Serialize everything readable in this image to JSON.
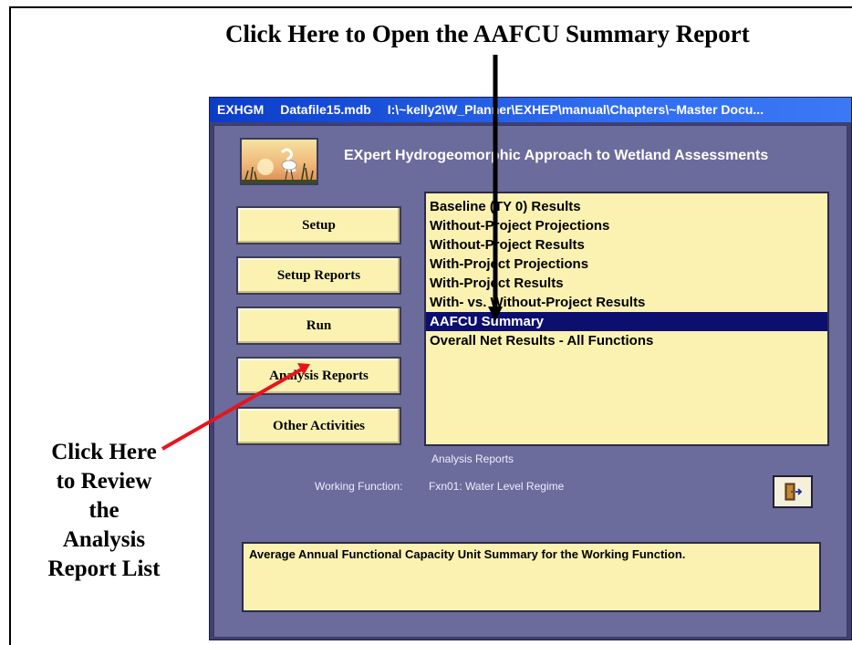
{
  "annotations": {
    "top_callout": "Click Here to Open the AAFCU Summary Report",
    "left_callout": [
      "Click Here",
      "to Review",
      "the",
      "Analysis",
      "Report List"
    ]
  },
  "window": {
    "title_parts": [
      "EXHGM",
      "Datafile15.mdb",
      "I:\\~kelly2\\W_Planner\\EXHEP\\manual\\Chapters\\~Master Docu..."
    ]
  },
  "app": {
    "title": "EXpert Hydrogeomorphic Approach to Wetland Assessments",
    "logo_icon": "heron-wetland-logo"
  },
  "nav": {
    "setup": "Setup",
    "setup_reports": "Setup Reports",
    "run": "Run",
    "analysis_reports": "Analysis Reports",
    "other_activities": "Other Activities"
  },
  "reports": {
    "items": [
      "Baseline (TY 0) Results",
      "Without-Project Projections",
      "Without-Project Results",
      "With-Project Projections",
      "With-Project Results",
      "With- vs. Without-Project Results",
      "AAFCU Summary",
      "Overall Net Results - All Functions"
    ],
    "selected": "AAFCU Summary",
    "caption": "Analysis Reports"
  },
  "working": {
    "label": "Working Function:",
    "value": "Fxn01: Water Level Regime"
  },
  "exit_icon": "exit-door-icon",
  "status": {
    "description": "Average Annual Functional Capacity Unit Summary for the Working Function."
  },
  "colors": {
    "background": "#6b6b9c",
    "button": "#fbf2b2",
    "selection": "#0d0f6e",
    "titlebar": "#0a3cc8",
    "arrow_red": "#e8141c"
  }
}
